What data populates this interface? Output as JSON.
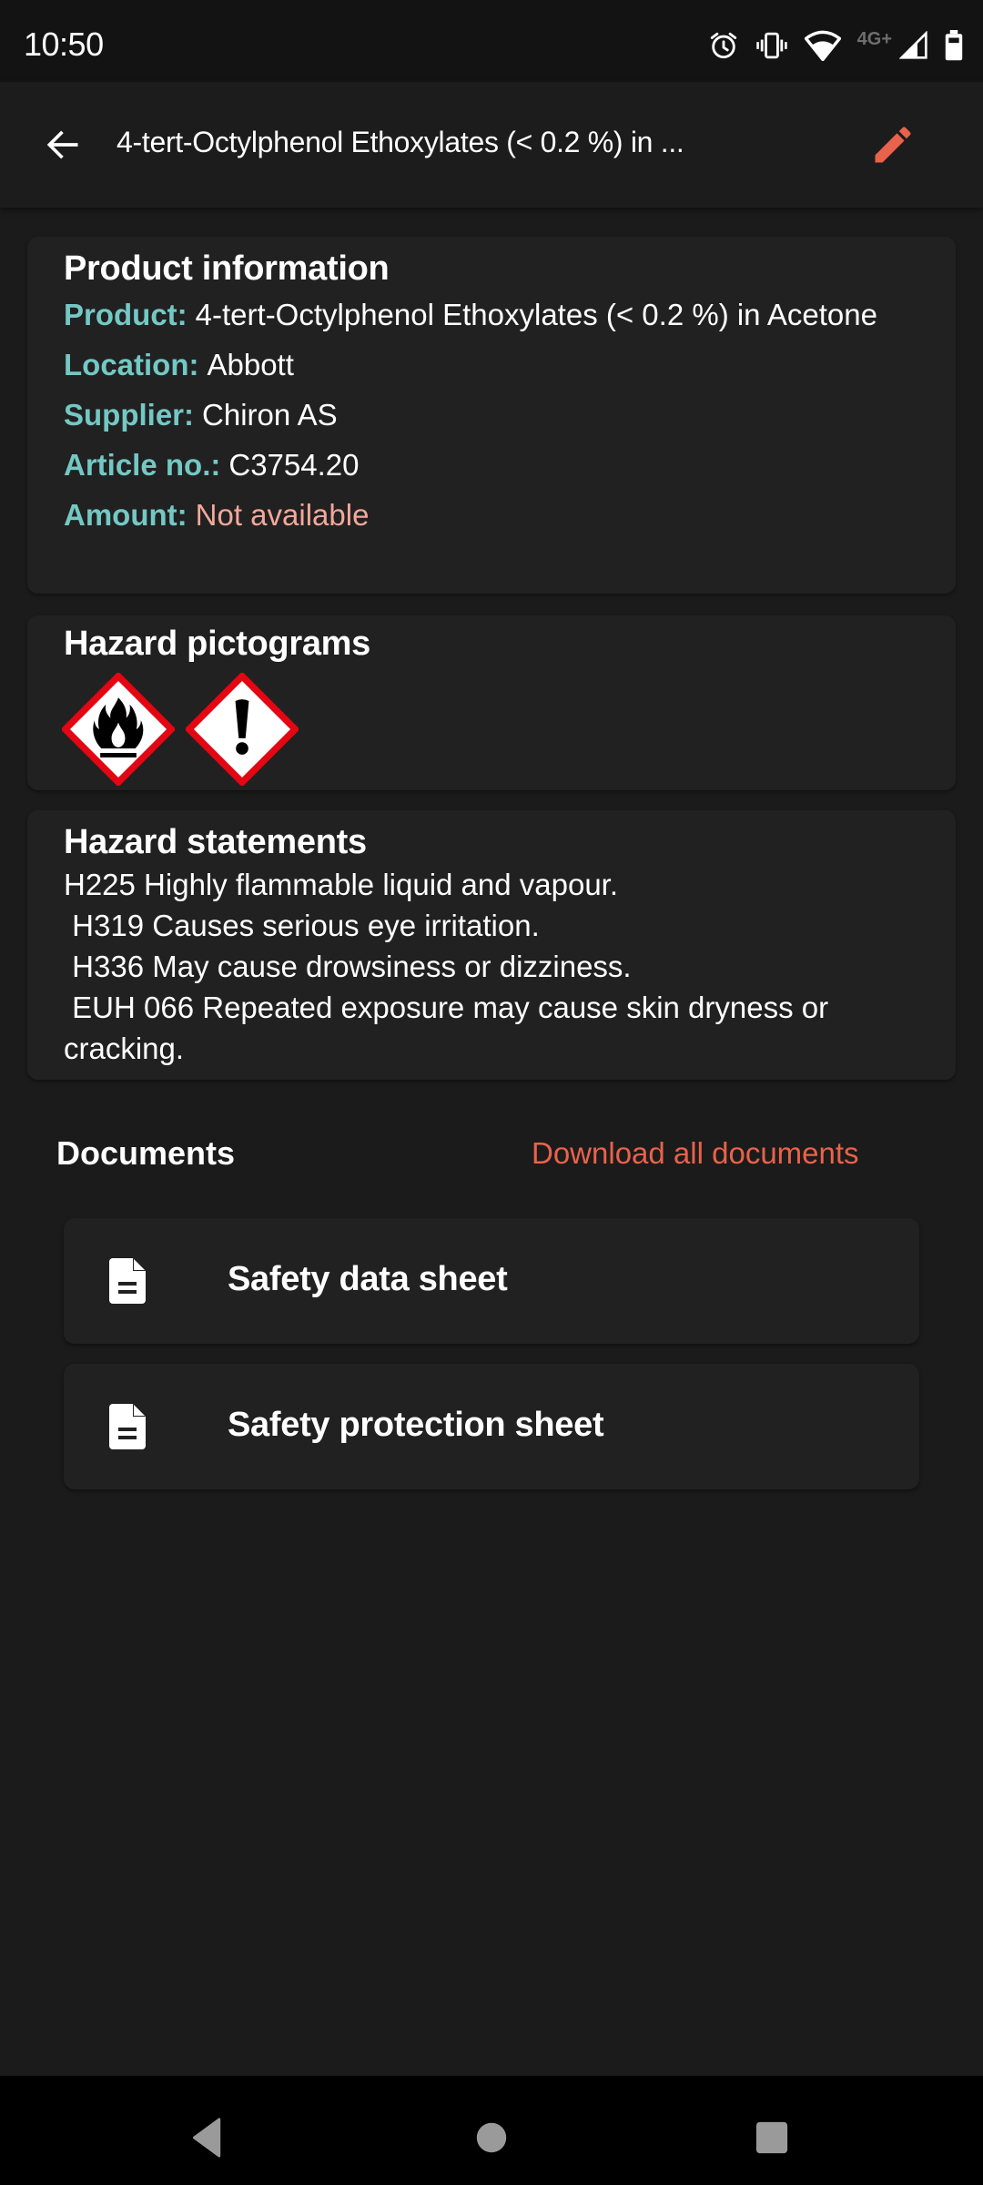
{
  "status_bar": {
    "time": "10:50",
    "network_label": "4G+",
    "icons": [
      "alarm-icon",
      "vibrate-icon",
      "wifi-icon",
      "signal-icon",
      "battery-icon"
    ]
  },
  "app_bar": {
    "title": "4-tert-Octylphenol Ethoxylates (< 0.2 %) in ...",
    "back_icon": "arrow-left-icon",
    "edit_icon": "pencil-icon",
    "accent_color": "#e9624b"
  },
  "product_info": {
    "title": "Product information",
    "rows": [
      {
        "label": "Product:",
        "value": "4-tert-Octylphenol Ethoxylates (< 0.2 %) in Acetone"
      },
      {
        "label": "Location:",
        "value": "Abbott"
      },
      {
        "label": "Supplier:",
        "value": "Chiron AS"
      },
      {
        "label": "Article no.:",
        "value": "C3754.20"
      },
      {
        "label": "Amount:",
        "value": "Not available"
      }
    ],
    "label_color": "#74c8c4",
    "unavailable_color": "#f2a89a"
  },
  "pictograms": {
    "title": "Hazard pictograms",
    "items": [
      {
        "name": "GHS02 flammable",
        "icon": "flame-pictogram-icon"
      },
      {
        "name": "GHS07 exclamation mark",
        "icon": "exclamation-pictogram-icon"
      }
    ]
  },
  "statements": {
    "title": "Hazard statements",
    "text": "H225 Highly flammable liquid and vapour.\n H319 Causes serious eye irritation.\n H336 May cause drowsiness or dizziness.\n EUH 066 Repeated exposure may cause skin dryness or cracking."
  },
  "documents": {
    "title": "Documents",
    "download_all_label": "Download all documents",
    "items": [
      {
        "label": "Safety data sheet",
        "icon": "document-icon"
      },
      {
        "label": "Safety protection sheet",
        "icon": "document-icon"
      }
    ]
  },
  "nav_bar": {
    "buttons": [
      "back",
      "home",
      "recents"
    ]
  }
}
